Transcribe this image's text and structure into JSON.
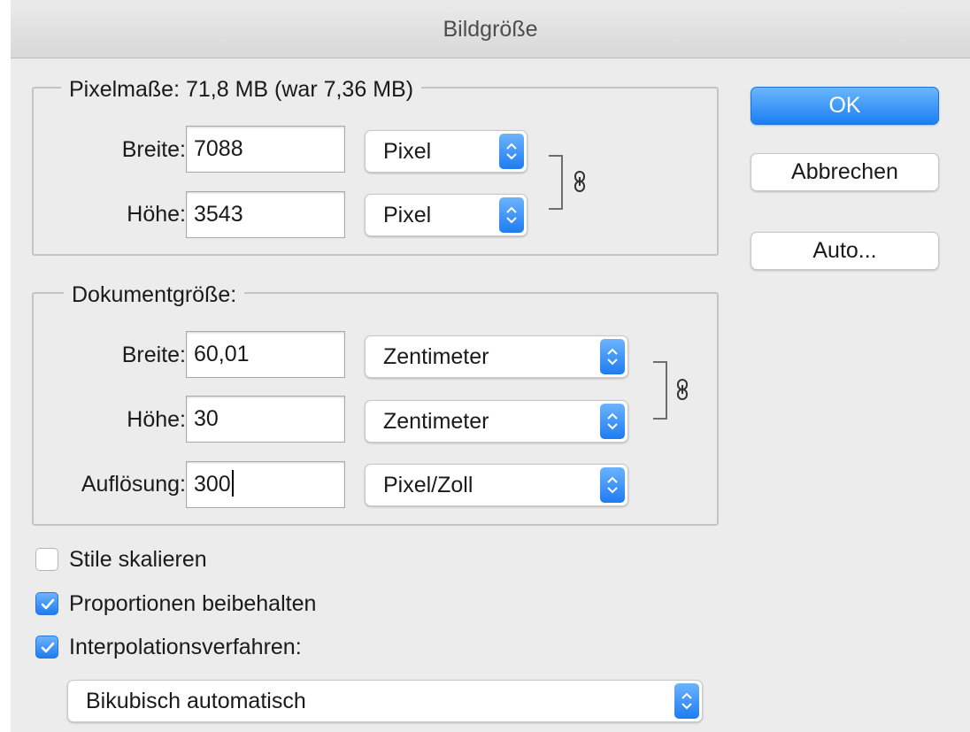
{
  "window": {
    "title": "Bildgröße"
  },
  "pixel_dimensions": {
    "legend": "Pixelmaße: 71,8 MB (war 7,36 MB)",
    "width": {
      "label": "Breite:",
      "value": "7088",
      "unit": "Pixel"
    },
    "height": {
      "label": "Höhe:",
      "value": "3543",
      "unit": "Pixel"
    },
    "link_icon": "chain-link-icon"
  },
  "document_size": {
    "legend": "Dokumentgröße:",
    "width": {
      "label": "Breite:",
      "value": "60,01",
      "unit": "Zentimeter"
    },
    "height": {
      "label": "Höhe:",
      "value": "30",
      "unit": "Zentimeter"
    },
    "resolution": {
      "label": "Auflösung:",
      "value": "300",
      "unit": "Pixel/Zoll"
    },
    "link_icon": "chain-link-icon"
  },
  "buttons": {
    "ok": "OK",
    "cancel": "Abbrechen",
    "auto": "Auto..."
  },
  "options": {
    "scale_styles": {
      "label": "Stile skalieren",
      "checked": false
    },
    "constrain_proportions": {
      "label": "Proportionen beibehalten",
      "checked": true
    },
    "resample": {
      "label": "Interpolationsverfahren:",
      "checked": true
    }
  },
  "resample_method": {
    "value": "Bikubisch automatisch"
  },
  "colors": {
    "accent": "#1e7cf2",
    "window_bg": "#ececec"
  }
}
